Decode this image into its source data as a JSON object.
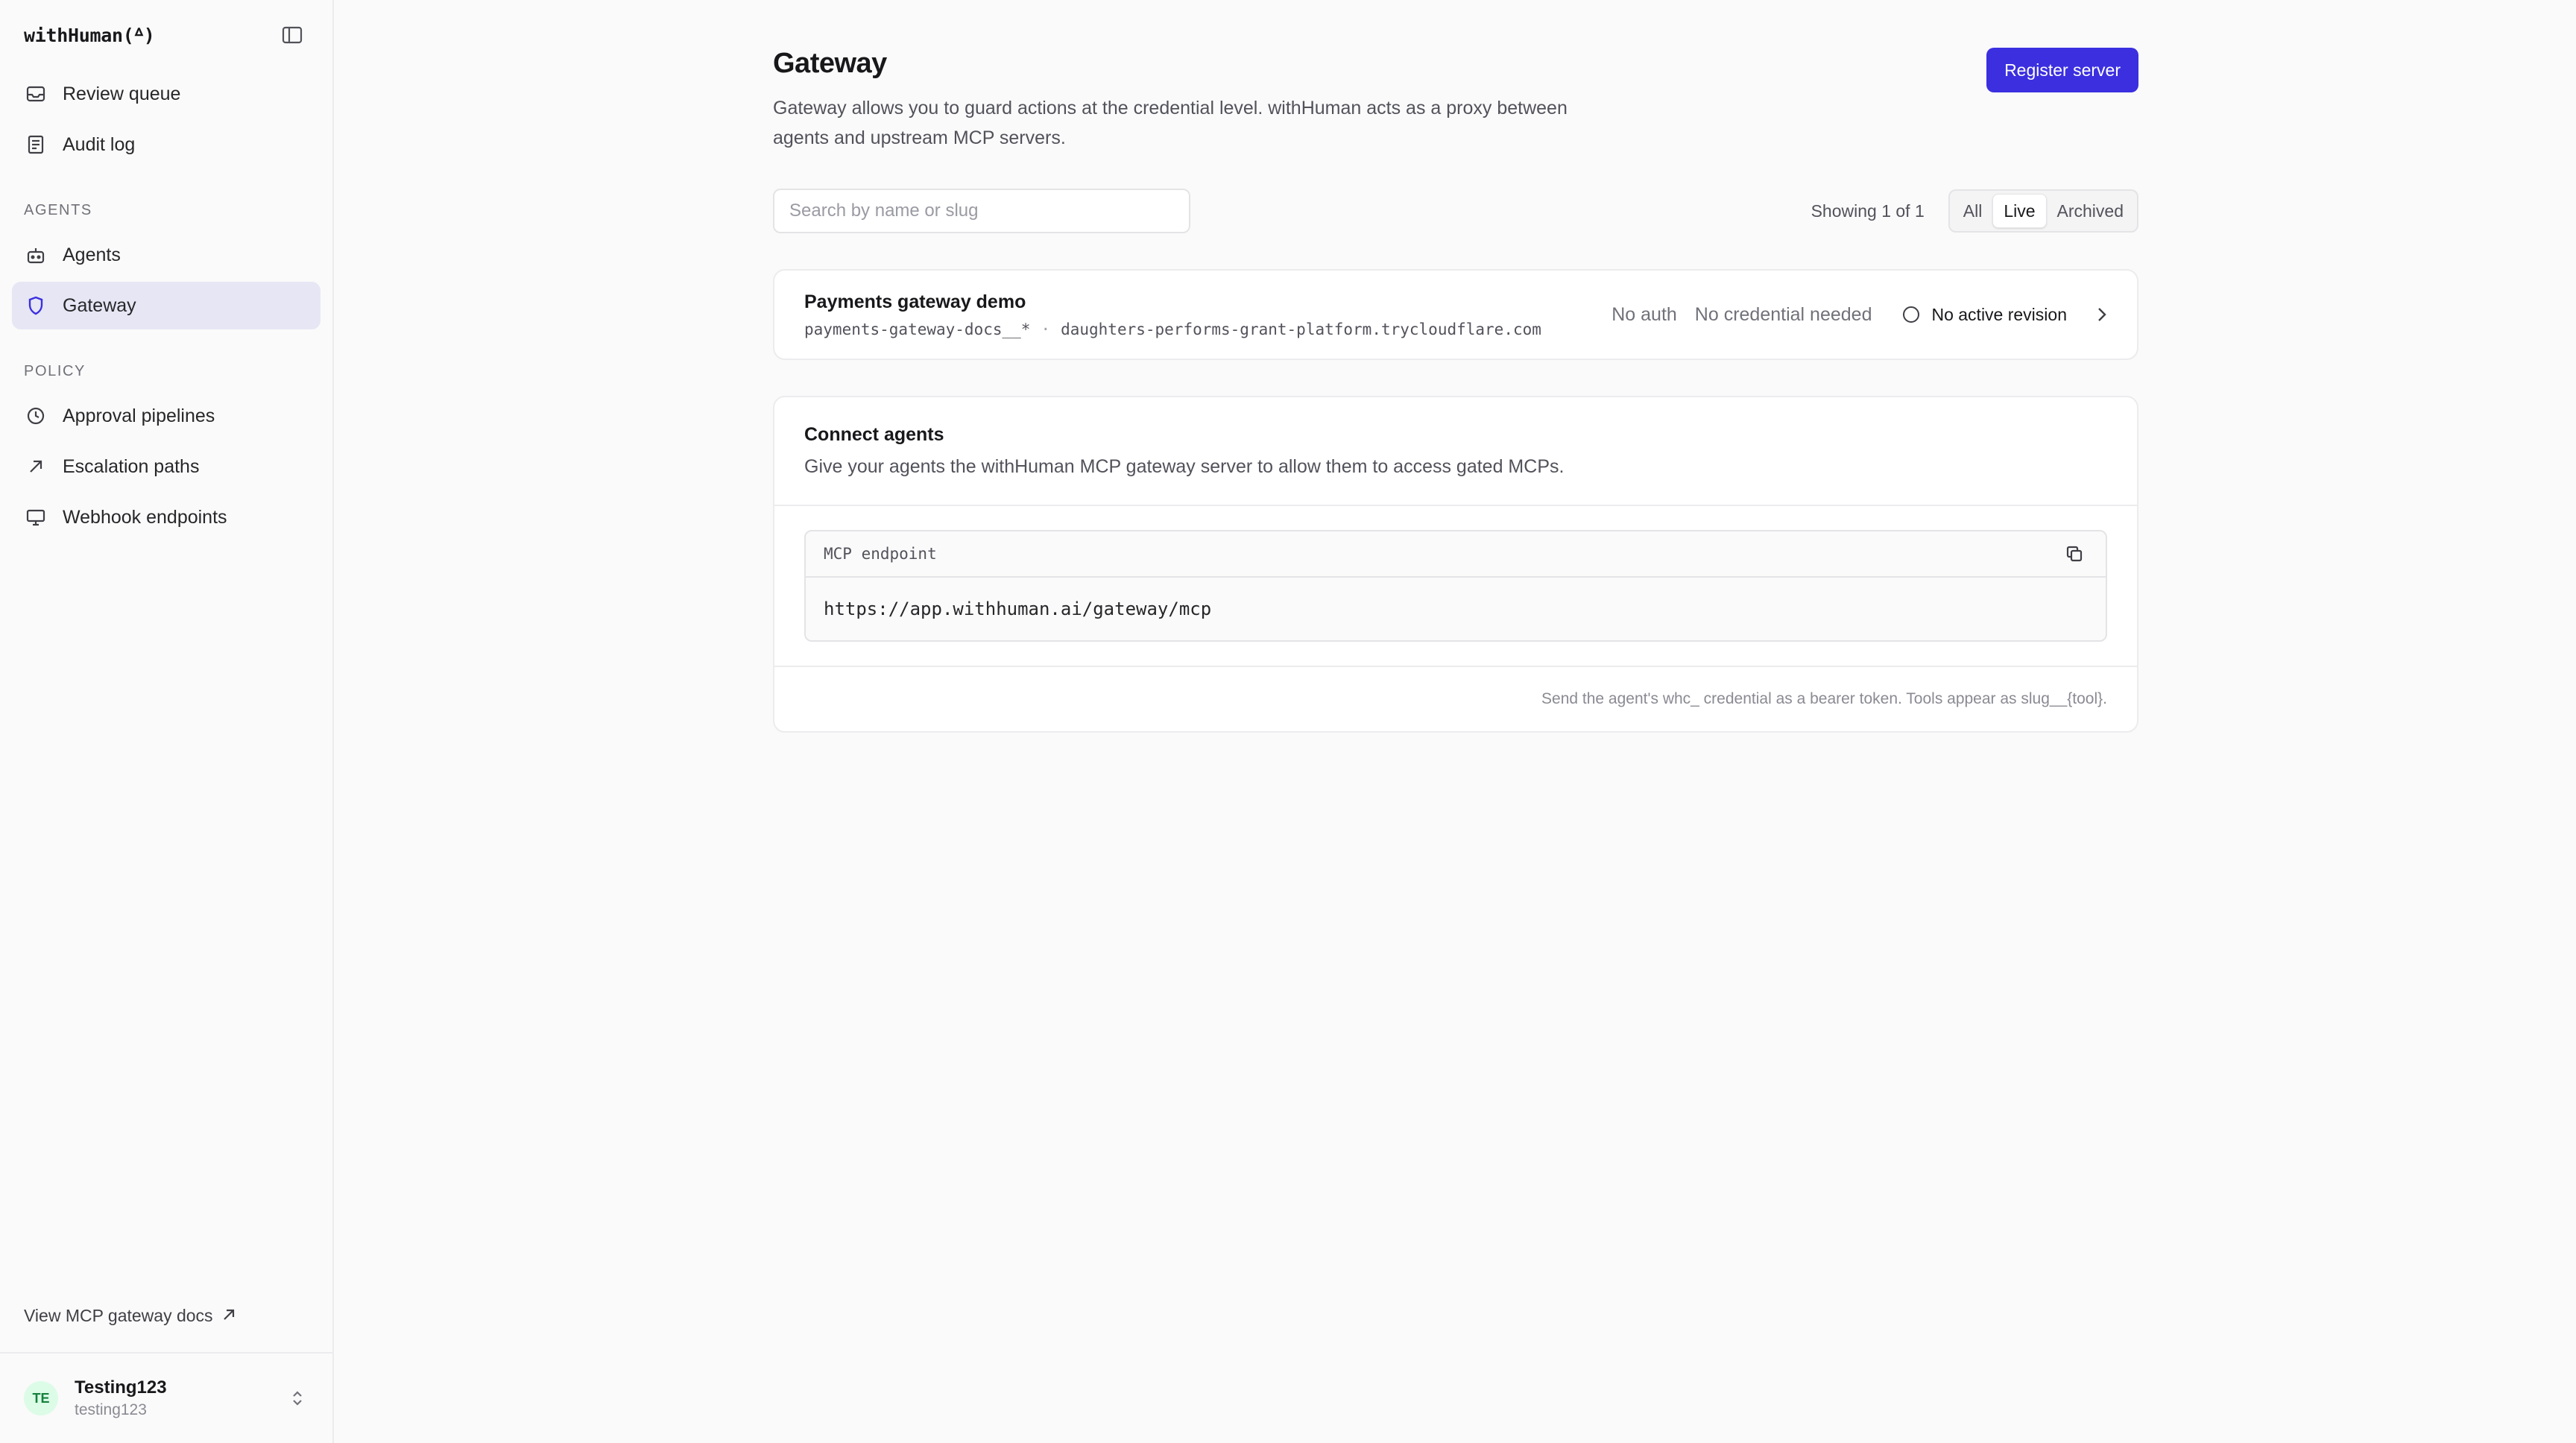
{
  "brand": {
    "name": "withHuman(ᐞ)"
  },
  "sidebar": {
    "top_items": [
      {
        "label": "Review queue",
        "icon": "inbox-icon"
      },
      {
        "label": "Audit log",
        "icon": "document-icon"
      }
    ],
    "sections": [
      {
        "title": "AGENTS",
        "items": [
          {
            "label": "Agents",
            "icon": "robot-icon"
          },
          {
            "label": "Gateway",
            "icon": "shield-icon",
            "active": true
          }
        ]
      },
      {
        "title": "POLICY",
        "items": [
          {
            "label": "Approval pipelines",
            "icon": "clock-icon"
          },
          {
            "label": "Escalation paths",
            "icon": "arrow-up-right-icon"
          },
          {
            "label": "Webhook endpoints",
            "icon": "monitor-icon"
          }
        ]
      }
    ],
    "docs_link": "View MCP gateway docs",
    "user": {
      "initials": "TE",
      "name": "Testing123",
      "handle": "testing123"
    }
  },
  "header": {
    "title": "Gateway",
    "description": "Gateway allows you to guard actions at the credential level. withHuman acts as a proxy between agents and upstream MCP servers.",
    "primary_button": "Register server"
  },
  "toolbar": {
    "search_placeholder": "Search by name or slug",
    "showing": "Showing 1 of 1",
    "filters": [
      "All",
      "Live",
      "Archived"
    ],
    "active_filter": "Live"
  },
  "server": {
    "name": "Payments gateway demo",
    "slug": "payments-gateway-docs__*",
    "separator": "·",
    "host": "daughters-performs-grant-platform.trycloudflare.com",
    "auth": "No auth",
    "credential": "No credential needed",
    "status": "No active revision"
  },
  "connect": {
    "title": "Connect agents",
    "description": "Give your agents the withHuman MCP gateway server to allow them to access gated MCPs.",
    "endpoint_label": "MCP endpoint",
    "endpoint_url": "https://app.withhuman.ai/gateway/mcp",
    "footnote": "Send the agent's whc_ credential as a bearer token. Tools appear as slug__{tool}."
  },
  "colors": {
    "accent": "#3b2fe0",
    "active_nav": "#e6e6f4",
    "avatar_bg": "#dcfce7",
    "avatar_fg": "#15803d"
  }
}
